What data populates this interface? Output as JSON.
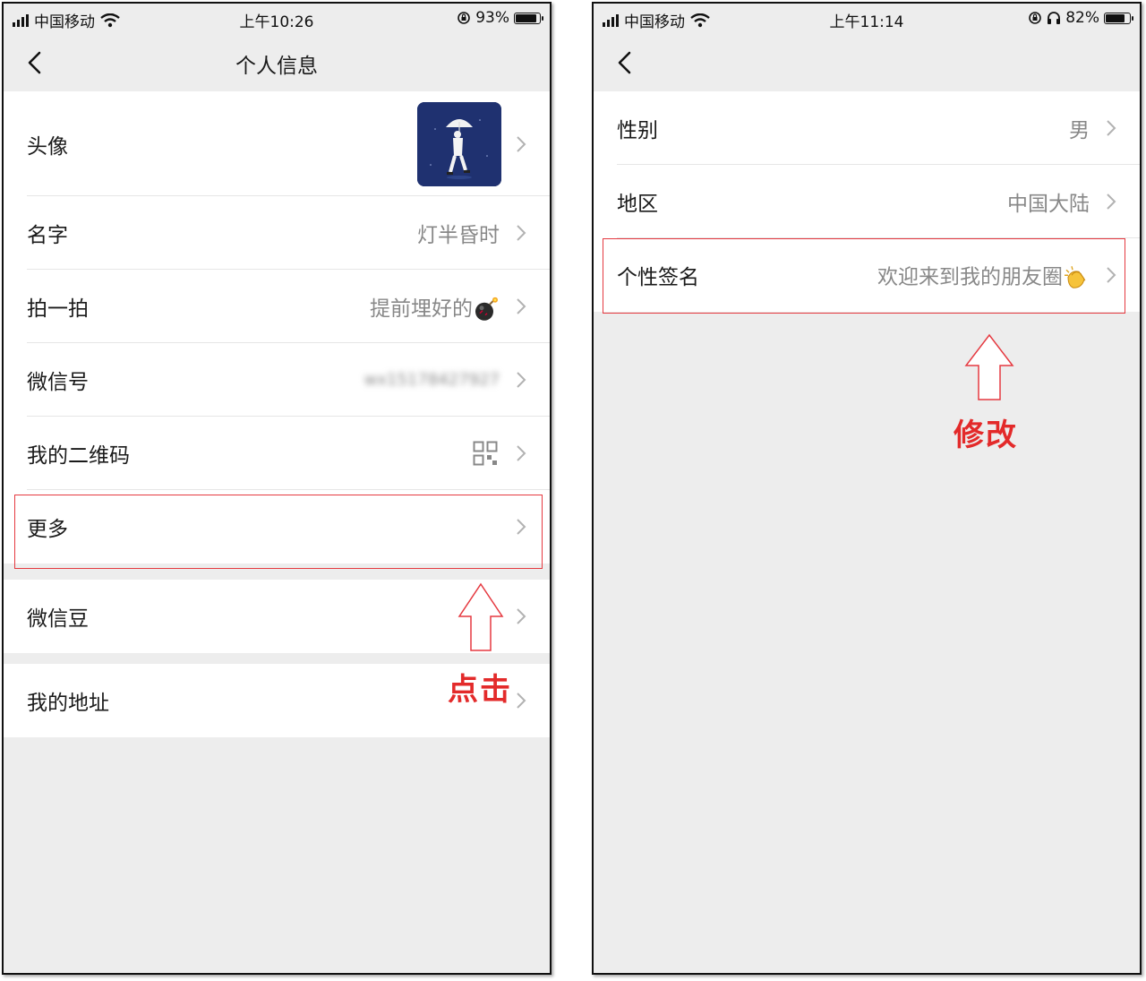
{
  "left_screen": {
    "status": {
      "carrier": "中国移动",
      "time": "上午10:26",
      "battery": "93%",
      "battery_level": 0.93
    },
    "nav": {
      "title": "个人信息"
    },
    "rows": [
      {
        "label": "头像",
        "value": ""
      },
      {
        "label": "名字",
        "value": "灯半昏时"
      },
      {
        "label": "拍一拍",
        "value": "提前埋好的"
      },
      {
        "label": "微信号",
        "value": "wx15178427927"
      },
      {
        "label": "我的二维码",
        "value": ""
      },
      {
        "label": "更多",
        "value": ""
      },
      {
        "label": "微信豆",
        "value": ""
      },
      {
        "label": "我的地址",
        "value": ""
      }
    ],
    "annotation": "点击"
  },
  "right_screen": {
    "status": {
      "carrier": "中国移动",
      "time": "上午11:14",
      "battery": "82%",
      "battery_level": 0.82
    },
    "rows": [
      {
        "label": "性别",
        "value": "男"
      },
      {
        "label": "地区",
        "value": "中国大陆"
      },
      {
        "label": "个性签名",
        "value": "欢迎来到我的朋友圈"
      }
    ],
    "annotation": "修改"
  },
  "icons": [
    "back-icon",
    "chevron-right-icon",
    "qr-code-icon",
    "bomb-icon",
    "clapping-hands-icon",
    "wifi-icon",
    "signal-icon",
    "battery-icon",
    "rotation-lock-icon",
    "headphones-icon",
    "red-up-arrow-icon"
  ],
  "colors": {
    "annotation_red": "#e53940",
    "page_bg": "#ededed",
    "value_gray": "#888888"
  }
}
